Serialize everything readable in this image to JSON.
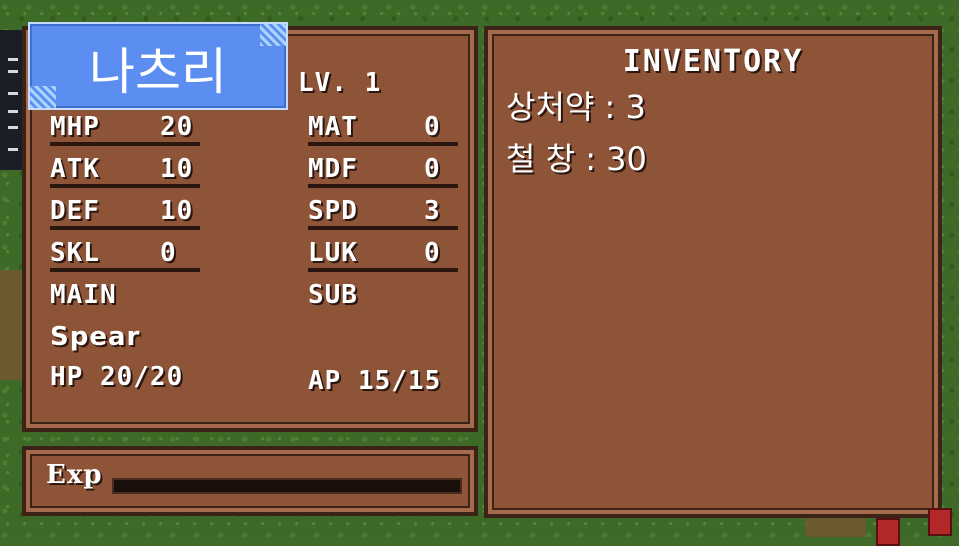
{
  "character": {
    "name": "나츠리",
    "level_label": "LV. 1"
  },
  "stats": [
    {
      "label": "MHP",
      "value": "20"
    },
    {
      "label": "ATK",
      "value": "10"
    },
    {
      "label": "DEF",
      "value": "10"
    },
    {
      "label": "SKL",
      "value": "0"
    },
    {
      "label": "MAT",
      "value": "0"
    },
    {
      "label": "MDF",
      "value": "0"
    },
    {
      "label": "SPD",
      "value": "3"
    },
    {
      "label": "LUK",
      "value": "0"
    }
  ],
  "equipment": {
    "main_label": "MAIN",
    "sub_label": "SUB",
    "main_value": "Spear"
  },
  "vitals": {
    "hp": "HP 20/20",
    "ap": "AP 15/15"
  },
  "exp": {
    "label": "Exp",
    "progress": 0
  },
  "inventory": {
    "title": "INVENTORY",
    "items": [
      "상처약 : 3",
      "철 창 : 30"
    ]
  },
  "colors": {
    "panel": "#8e5438",
    "panel_border": "#3b2318",
    "name_tag": "#5b8ef0",
    "grass": "#3e6a27"
  }
}
